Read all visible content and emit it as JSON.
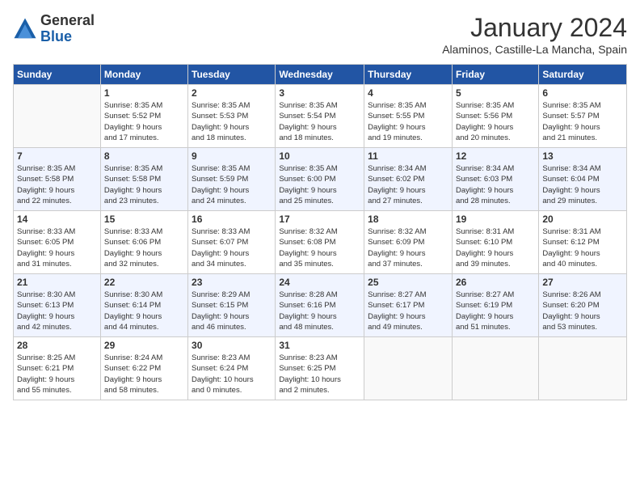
{
  "header": {
    "logo": {
      "line1": "General",
      "line2": "Blue"
    },
    "title": "January 2024",
    "location": "Alaminos, Castille-La Mancha, Spain"
  },
  "days_of_week": [
    "Sunday",
    "Monday",
    "Tuesday",
    "Wednesday",
    "Thursday",
    "Friday",
    "Saturday"
  ],
  "weeks": [
    [
      {
        "day": "",
        "info": ""
      },
      {
        "day": "1",
        "info": "Sunrise: 8:35 AM\nSunset: 5:52 PM\nDaylight: 9 hours\nand 17 minutes."
      },
      {
        "day": "2",
        "info": "Sunrise: 8:35 AM\nSunset: 5:53 PM\nDaylight: 9 hours\nand 18 minutes."
      },
      {
        "day": "3",
        "info": "Sunrise: 8:35 AM\nSunset: 5:54 PM\nDaylight: 9 hours\nand 18 minutes."
      },
      {
        "day": "4",
        "info": "Sunrise: 8:35 AM\nSunset: 5:55 PM\nDaylight: 9 hours\nand 19 minutes."
      },
      {
        "day": "5",
        "info": "Sunrise: 8:35 AM\nSunset: 5:56 PM\nDaylight: 9 hours\nand 20 minutes."
      },
      {
        "day": "6",
        "info": "Sunrise: 8:35 AM\nSunset: 5:57 PM\nDaylight: 9 hours\nand 21 minutes."
      }
    ],
    [
      {
        "day": "7",
        "info": "Sunrise: 8:35 AM\nSunset: 5:58 PM\nDaylight: 9 hours\nand 22 minutes."
      },
      {
        "day": "8",
        "info": "Sunrise: 8:35 AM\nSunset: 5:58 PM\nDaylight: 9 hours\nand 23 minutes."
      },
      {
        "day": "9",
        "info": "Sunrise: 8:35 AM\nSunset: 5:59 PM\nDaylight: 9 hours\nand 24 minutes."
      },
      {
        "day": "10",
        "info": "Sunrise: 8:35 AM\nSunset: 6:00 PM\nDaylight: 9 hours\nand 25 minutes."
      },
      {
        "day": "11",
        "info": "Sunrise: 8:34 AM\nSunset: 6:02 PM\nDaylight: 9 hours\nand 27 minutes."
      },
      {
        "day": "12",
        "info": "Sunrise: 8:34 AM\nSunset: 6:03 PM\nDaylight: 9 hours\nand 28 minutes."
      },
      {
        "day": "13",
        "info": "Sunrise: 8:34 AM\nSunset: 6:04 PM\nDaylight: 9 hours\nand 29 minutes."
      }
    ],
    [
      {
        "day": "14",
        "info": "Sunrise: 8:33 AM\nSunset: 6:05 PM\nDaylight: 9 hours\nand 31 minutes."
      },
      {
        "day": "15",
        "info": "Sunrise: 8:33 AM\nSunset: 6:06 PM\nDaylight: 9 hours\nand 32 minutes."
      },
      {
        "day": "16",
        "info": "Sunrise: 8:33 AM\nSunset: 6:07 PM\nDaylight: 9 hours\nand 34 minutes."
      },
      {
        "day": "17",
        "info": "Sunrise: 8:32 AM\nSunset: 6:08 PM\nDaylight: 9 hours\nand 35 minutes."
      },
      {
        "day": "18",
        "info": "Sunrise: 8:32 AM\nSunset: 6:09 PM\nDaylight: 9 hours\nand 37 minutes."
      },
      {
        "day": "19",
        "info": "Sunrise: 8:31 AM\nSunset: 6:10 PM\nDaylight: 9 hours\nand 39 minutes."
      },
      {
        "day": "20",
        "info": "Sunrise: 8:31 AM\nSunset: 6:12 PM\nDaylight: 9 hours\nand 40 minutes."
      }
    ],
    [
      {
        "day": "21",
        "info": "Sunrise: 8:30 AM\nSunset: 6:13 PM\nDaylight: 9 hours\nand 42 minutes."
      },
      {
        "day": "22",
        "info": "Sunrise: 8:30 AM\nSunset: 6:14 PM\nDaylight: 9 hours\nand 44 minutes."
      },
      {
        "day": "23",
        "info": "Sunrise: 8:29 AM\nSunset: 6:15 PM\nDaylight: 9 hours\nand 46 minutes."
      },
      {
        "day": "24",
        "info": "Sunrise: 8:28 AM\nSunset: 6:16 PM\nDaylight: 9 hours\nand 48 minutes."
      },
      {
        "day": "25",
        "info": "Sunrise: 8:27 AM\nSunset: 6:17 PM\nDaylight: 9 hours\nand 49 minutes."
      },
      {
        "day": "26",
        "info": "Sunrise: 8:27 AM\nSunset: 6:19 PM\nDaylight: 9 hours\nand 51 minutes."
      },
      {
        "day": "27",
        "info": "Sunrise: 8:26 AM\nSunset: 6:20 PM\nDaylight: 9 hours\nand 53 minutes."
      }
    ],
    [
      {
        "day": "28",
        "info": "Sunrise: 8:25 AM\nSunset: 6:21 PM\nDaylight: 9 hours\nand 55 minutes."
      },
      {
        "day": "29",
        "info": "Sunrise: 8:24 AM\nSunset: 6:22 PM\nDaylight: 9 hours\nand 58 minutes."
      },
      {
        "day": "30",
        "info": "Sunrise: 8:23 AM\nSunset: 6:24 PM\nDaylight: 10 hours\nand 0 minutes."
      },
      {
        "day": "31",
        "info": "Sunrise: 8:23 AM\nSunset: 6:25 PM\nDaylight: 10 hours\nand 2 minutes."
      },
      {
        "day": "",
        "info": ""
      },
      {
        "day": "",
        "info": ""
      },
      {
        "day": "",
        "info": ""
      }
    ]
  ]
}
